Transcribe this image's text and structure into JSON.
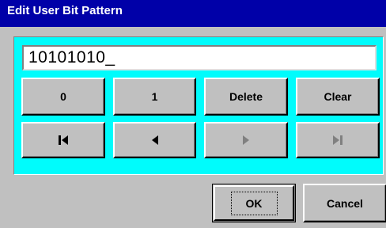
{
  "window": {
    "title": "Edit User Bit Pattern"
  },
  "pattern_field": {
    "value": "10101010_"
  },
  "keypad": {
    "zero_label": "0",
    "one_label": "1",
    "delete_label": "Delete",
    "clear_label": "Clear"
  },
  "navigation": {
    "first_icon": "skip-to-start-icon",
    "left_icon": "arrow-left-icon",
    "right_icon": "arrow-right-icon",
    "last_icon": "skip-to-end-icon",
    "right_enabled": false,
    "last_enabled": false
  },
  "actions": {
    "ok_label": "OK",
    "cancel_label": "Cancel"
  },
  "colors": {
    "title_bar": "#0000a8",
    "panel": "#00fcfc",
    "face": "#c0c0c0",
    "disabled": "#808080"
  }
}
